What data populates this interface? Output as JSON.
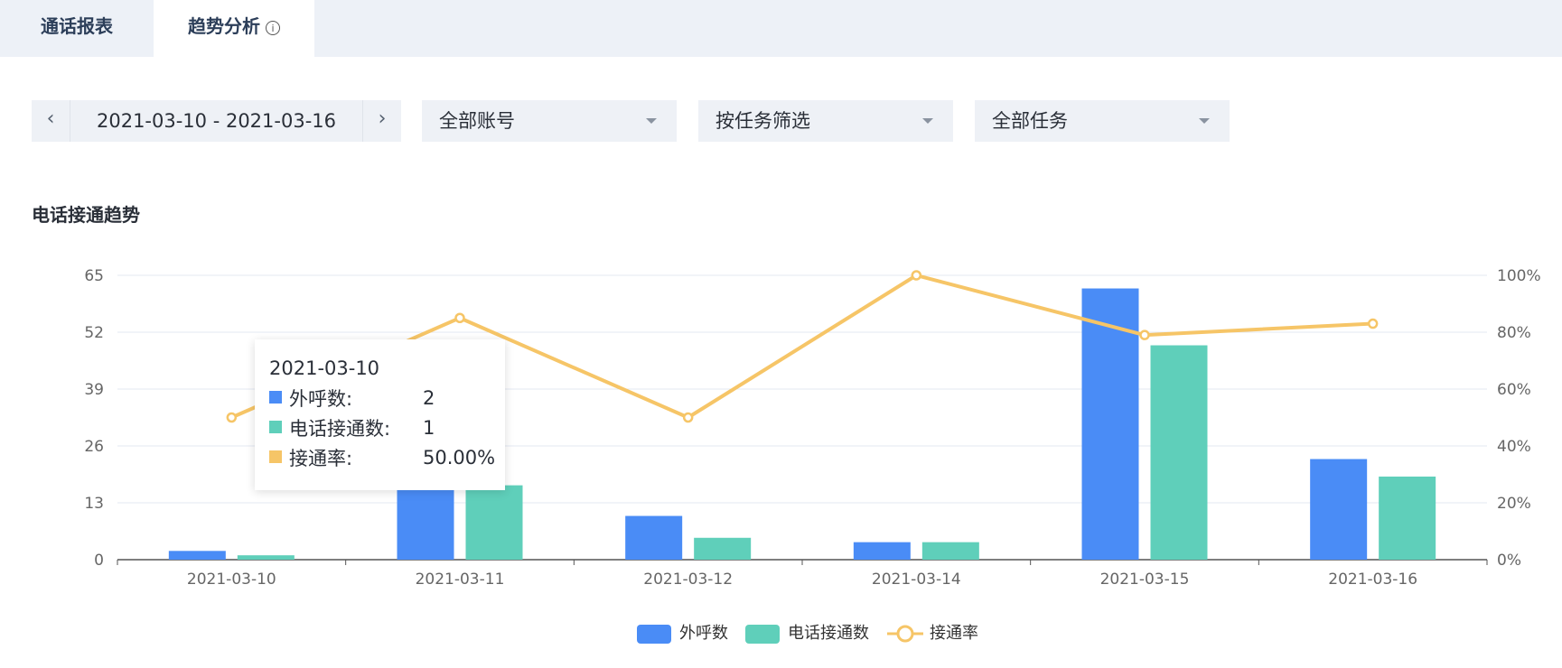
{
  "tabs": [
    {
      "label": "通话报表",
      "active": false
    },
    {
      "label": "趋势分析",
      "active": true
    }
  ],
  "tab_info_icon": "info-icon",
  "filters": {
    "date_range": "2021-03-10 - 2021-03-16",
    "prev_icon": "chevron-left-icon",
    "next_icon": "chevron-right-icon",
    "account_select": "全部账号",
    "task_filter_select": "按任务筛选",
    "task_select": "全部任务"
  },
  "colors": {
    "bar_outbound": "#4a8cf6",
    "bar_connected": "#5fcfba",
    "line_rate": "#f6c567",
    "grid": "#e3e8f2",
    "axis_text": "#666666"
  },
  "chart_data": {
    "type": "bar",
    "title": "电话接通趋势",
    "categories": [
      "2021-03-10",
      "2021-03-11",
      "2021-03-12",
      "2021-03-14",
      "2021-03-15",
      "2021-03-16"
    ],
    "series": [
      {
        "name": "外呼数",
        "type": "bar",
        "axis": "left",
        "values": [
          2,
          20,
          10,
          4,
          62,
          23
        ]
      },
      {
        "name": "电话接通数",
        "type": "bar",
        "axis": "left",
        "values": [
          1,
          17,
          5,
          4,
          49,
          19
        ]
      },
      {
        "name": "接通率",
        "type": "line",
        "axis": "right",
        "values": [
          50,
          85,
          50,
          100,
          79,
          83
        ]
      }
    ],
    "y_left": {
      "min": 0,
      "max": 65,
      "ticks": [
        "0",
        "13",
        "26",
        "39",
        "52",
        "65"
      ]
    },
    "y_right": {
      "min": 0,
      "max": 100,
      "ticks": [
        "0%",
        "20%",
        "40%",
        "60%",
        "80%",
        "100%"
      ]
    },
    "grid": true,
    "legend_position": "bottom-center",
    "tooltip": {
      "date": "2021-03-10",
      "rows": [
        {
          "label": "外呼数:",
          "value": "2"
        },
        {
          "label": "电话接通数:",
          "value": "1"
        },
        {
          "label": "接通率:",
          "value": "50.00%"
        }
      ]
    }
  }
}
